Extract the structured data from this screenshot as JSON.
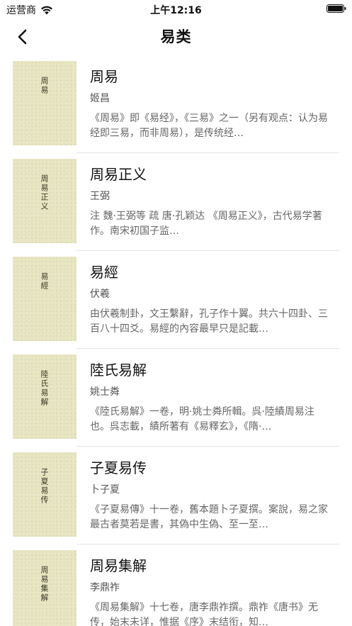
{
  "status_bar": {
    "carrier": "运营商",
    "time": "上午12:16"
  },
  "nav": {
    "title": "易类"
  },
  "books": [
    {
      "cover_title": "周易",
      "title": "周易",
      "author": "姬昌",
      "description": "《周易》即《易经》，《三易》之一（另有观点：认为易经即三易，而非周易），是传统经…"
    },
    {
      "cover_title": "周易正义",
      "title": "周易正义",
      "author": "王弼",
      "description": "注 魏·王弼等 疏 唐·孔颖达 《周易正义》，古代易学著作。南宋初国子监…"
    },
    {
      "cover_title": "易經",
      "title": "易經",
      "author": "伏羲",
      "description": "由伏羲制卦，文王繫辭，孔子作十翼。共六十四卦、三百八十四爻。易經的內容最早只是記載…"
    },
    {
      "cover_title": "陸氏易解",
      "title": "陸氏易解",
      "author": "姚士粦",
      "description": "《陸氏易解》一卷，明·姚士粦所輯。呉·陸績周易注也。呉志載，績所著有《易釋玄》，《隋·…"
    },
    {
      "cover_title": "子夏易传",
      "title": "子夏易传",
      "author": "卜子夏",
      "description": "《子夏易傳》十一卷，舊本題卜子夏撰。案說，易之家最古者莫若是書，其偽中生偽、至一至…"
    },
    {
      "cover_title": "周易集解",
      "title": "周易集解",
      "author": "李鼎祚",
      "description": "《周易集解》十七卷，唐李鼎祚撰。鼎祚《唐书》无传，始末未详，惟据《序》末结衔，知…"
    }
  ]
}
